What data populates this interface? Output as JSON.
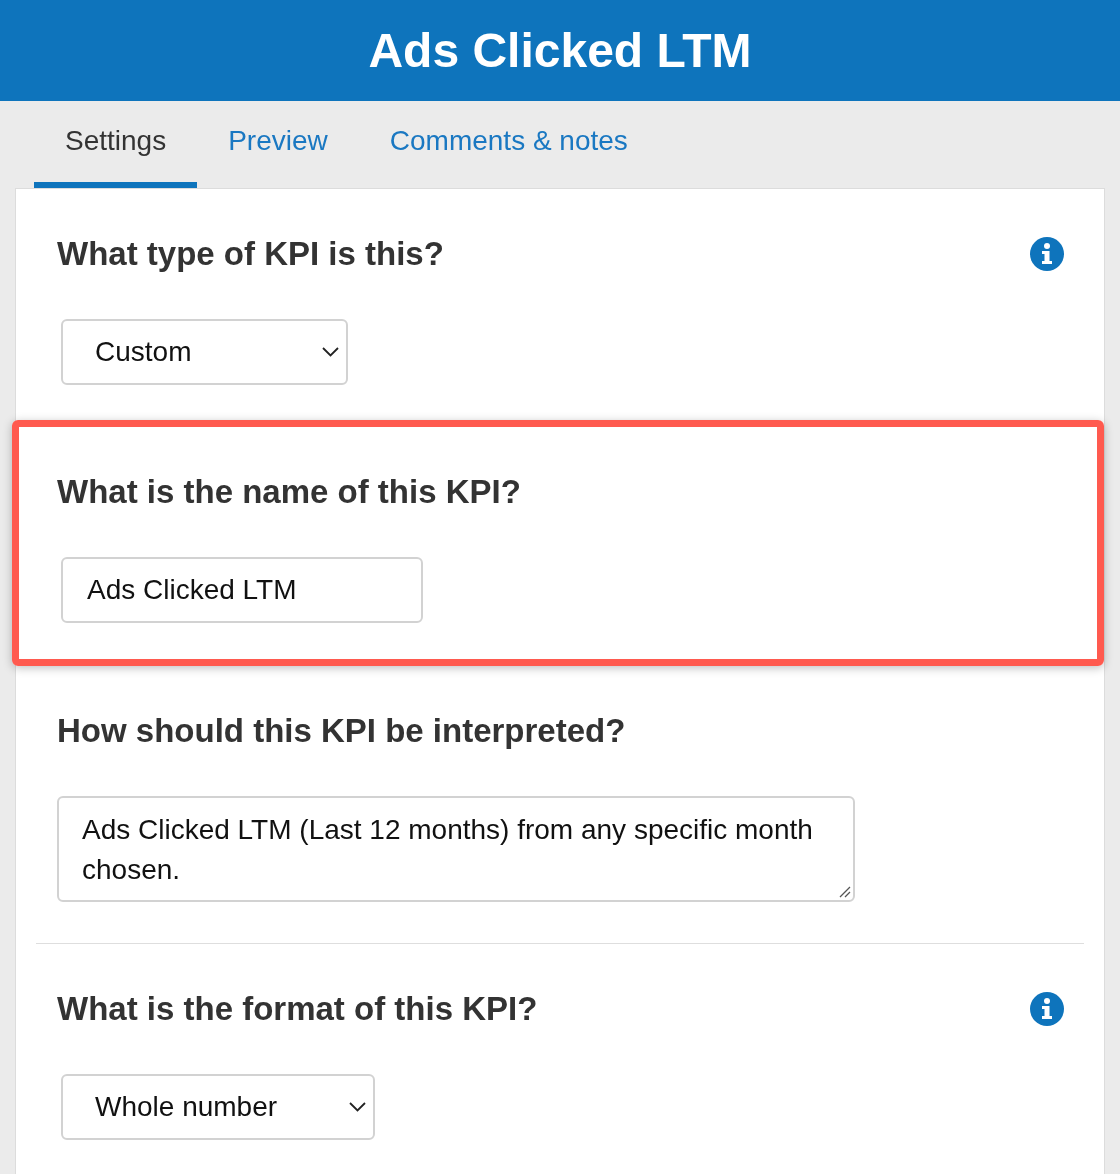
{
  "header": {
    "title": "Ads Clicked LTM"
  },
  "tabs": [
    {
      "label": "Settings",
      "selected": true
    },
    {
      "label": "Preview",
      "selected": false
    },
    {
      "label": "Comments & notes",
      "selected": false
    }
  ],
  "sections": [
    {
      "question": "What type of KPI is this?",
      "info": true,
      "highlighted": false,
      "divider_above": false,
      "field": {
        "kind": "select",
        "value": "Custom"
      }
    },
    {
      "question": "What is the name of this KPI?",
      "info": false,
      "highlighted": true,
      "divider_above": false,
      "field": {
        "kind": "input",
        "value": "Ads Clicked LTM"
      }
    },
    {
      "question": "How should this KPI be interpreted?",
      "info": false,
      "highlighted": false,
      "divider_above": false,
      "field": {
        "kind": "textarea",
        "value": "Ads Clicked LTM (Last 12 months) from any specific month chosen."
      }
    },
    {
      "question": "What is the format of this KPI?",
      "info": true,
      "highlighted": false,
      "divider_above": true,
      "field": {
        "kind": "select",
        "value": "Whole number"
      }
    }
  ]
}
